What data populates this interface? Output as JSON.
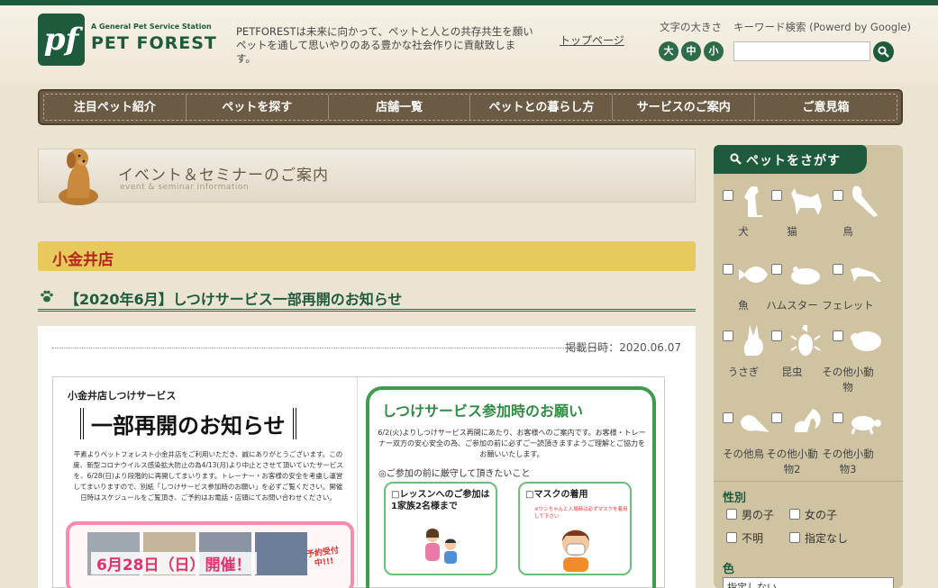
{
  "header": {
    "logo_mark": "pf",
    "logo_sub": "A General Pet Service Station",
    "logo_name": "PET FOREST",
    "tagline": "PETFORESTは未来に向かって、ペットと人との共存共生を願いペットを通して思いやりのある豊かな社会作りに貢献致します。",
    "top_link": "トップページ",
    "font_size_label": "文字の大きさ",
    "font_sizes": [
      "大",
      "中",
      "小"
    ],
    "search_label": "キーワード検索 (Powerd by Google)",
    "search_value": "",
    "search_icon": "search-icon"
  },
  "nav": {
    "items": [
      "注目ペット紹介",
      "ペットを探す",
      "店舗一覧",
      "ペットとの暮らし方",
      "サービスのご案内",
      "ご意見箱"
    ]
  },
  "event_banner": {
    "title": "イベント＆セミナーのご案内",
    "subtitle": "event & seminar information"
  },
  "store": {
    "name": "小金井店"
  },
  "post": {
    "title": "【2020年6月】しつけサービス一部再開のお知らせ",
    "date": "掲載日時：2020.06.07"
  },
  "flyer": {
    "left_small": "小金井店しつけサービス",
    "left_big": "一部再開のお知らせ",
    "left_para": "平素よりペットフォレスト小金井店をご利用いただき、誠にありがとうございます。この度、新型コロナウイルス感染拡大防止の為4/13(月)より中止とさせて頂いていたサービスを、6/28(日)より段階的に再開してまいります。トレーナー・お客様の安全を考慮し運営してまいりますので、別紙「しつけサービス参加時のお願い」を必ずご覧ください。開催日時はスケジュールをご覧頂き、ご予約はお電話・店頭にてお問い合わせください。",
    "left_open": "6月28日（日）開催！",
    "left_reserve": "予約受付中!!!",
    "right_title": "しつけサービス参加時のお願い",
    "right_para": "6/2(火)よりしつけサービス再開にあたり、お客様へのご案内です。お客様・トレーナー双方の安心安全の為、ご参加の前に必ずご一読頂きますようご理解とご協力をお願いいたします。",
    "right_rule": "◎ご参加の前に厳守して頂きたいこと",
    "card1_title": "□レッスンへのご参加は1家族2名様まで",
    "card2_title": "□マスクの着用",
    "card2_note": "※ワンちゃんと入場時は必ずマスクを着用して下さい"
  },
  "sidebar": {
    "heading": "ペットをさがす",
    "pets": [
      {
        "label": "犬",
        "icon": "dog-icon"
      },
      {
        "label": "猫",
        "icon": "cat-icon"
      },
      {
        "label": "鳥",
        "icon": "bird-icon"
      },
      {
        "label": "魚",
        "icon": "fish-icon"
      },
      {
        "label": "ハムスター",
        "icon": "hamster-icon"
      },
      {
        "label": "フェレット",
        "icon": "ferret-icon"
      },
      {
        "label": "うさぎ",
        "icon": "rabbit-icon"
      },
      {
        "label": "昆虫",
        "icon": "beetle-icon"
      },
      {
        "label": "その他小動物",
        "icon": "small-animal-icon"
      },
      {
        "label": "その他鳥",
        "icon": "other-bird-icon"
      },
      {
        "label": "その他小動物2",
        "icon": "squirrel-icon"
      },
      {
        "label": "その他小動物3",
        "icon": "turtle-icon"
      }
    ],
    "gender_label": "性別",
    "gender_options": [
      "男の子",
      "女の子",
      "不明",
      "指定なし"
    ],
    "color_label": "色",
    "color_select": "指定しない"
  },
  "colors": {
    "brand_green": "#1e5a3c",
    "nav_brown": "#6b5a44",
    "store_bar": "#e8c95e",
    "store_text": "#b3261e",
    "sidebar_bg": "#cfc3a2"
  }
}
